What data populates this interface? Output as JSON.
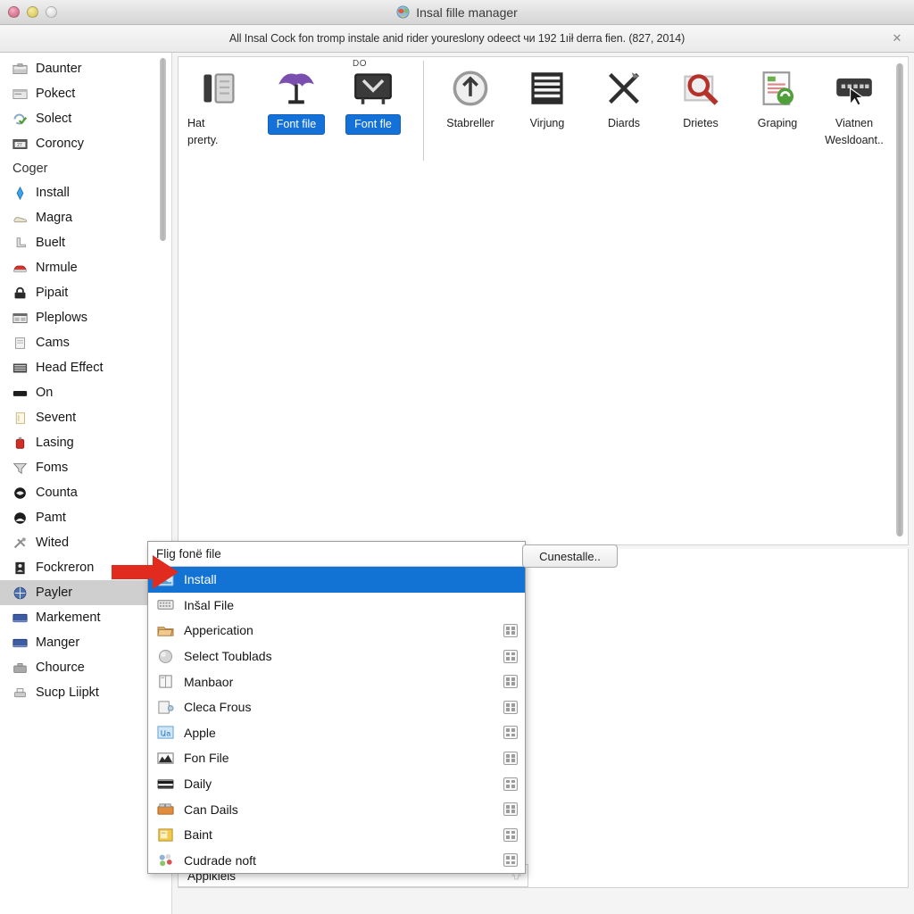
{
  "window": {
    "title": "Insal fille manager",
    "title_icon": "app-globe-icon",
    "controls": {
      "close": "close",
      "minimize": "minimize",
      "zoom": "zoom"
    }
  },
  "notice": {
    "text": "All Insal Cock fon tromp instale anid rider youreslony odeect чи 192 1ıił derra fien. (827, 2014)",
    "close_label": "✕"
  },
  "sidebar": {
    "items": [
      {
        "label": "Daunter",
        "icon": "briefcase-icon",
        "type": "item",
        "selected": false
      },
      {
        "label": "Pokect",
        "icon": "window-icon",
        "type": "item",
        "selected": false
      },
      {
        "label": "Solect",
        "icon": "refresh-check-icon",
        "type": "item",
        "selected": false
      },
      {
        "label": "Coroncy",
        "icon": "calendar-icon",
        "type": "item",
        "selected": false
      },
      {
        "label": "Coger",
        "icon": "",
        "type": "group",
        "selected": false
      },
      {
        "label": "Install",
        "icon": "blue-diamond-icon",
        "type": "item",
        "selected": false
      },
      {
        "label": "Magra",
        "icon": "shoe-icon",
        "type": "item",
        "selected": false
      },
      {
        "label": "Buelt",
        "icon": "boot-icon",
        "type": "item",
        "selected": false
      },
      {
        "label": "Nrmule",
        "icon": "car-icon",
        "type": "item",
        "selected": false
      },
      {
        "label": "Pipait",
        "icon": "lock-icon",
        "type": "item",
        "selected": false
      },
      {
        "label": "Pleplows",
        "icon": "grid-window-icon",
        "type": "item",
        "selected": false
      },
      {
        "label": "Cams",
        "icon": "document-icon",
        "type": "item",
        "selected": false
      },
      {
        "label": "Head Effect",
        "icon": "stripes-icon",
        "type": "item",
        "selected": false
      },
      {
        "label": "On",
        "icon": "black-bar-icon",
        "type": "item",
        "selected": false
      },
      {
        "label": "Sevent",
        "icon": "note-icon",
        "type": "item",
        "selected": false
      },
      {
        "label": "Lasing",
        "icon": "red-canister-icon",
        "type": "item",
        "selected": false
      },
      {
        "label": "Foms",
        "icon": "funnel-icon",
        "type": "item",
        "selected": false
      },
      {
        "label": "Counta",
        "icon": "globe-dark-icon",
        "type": "item",
        "selected": false
      },
      {
        "label": "Pamt",
        "icon": "circle-dark-icon",
        "type": "item",
        "selected": false
      },
      {
        "label": "Wited",
        "icon": "tools-icon",
        "type": "item",
        "selected": false
      },
      {
        "label": "Fockreron",
        "icon": "person-badge-icon",
        "type": "item",
        "selected": false
      },
      {
        "label": "Payler",
        "icon": "blue-globe-icon",
        "type": "item",
        "selected": true
      },
      {
        "label": "Markement",
        "icon": "blue-screen-icon",
        "type": "item",
        "selected": false
      },
      {
        "label": "Manger",
        "icon": "blue-screen-icon",
        "type": "item",
        "selected": false
      },
      {
        "label": "Chource",
        "icon": "toolbox-icon",
        "type": "item",
        "selected": false
      },
      {
        "label": "Sucp Liipkt",
        "icon": "printer-icon",
        "type": "item",
        "selected": false
      }
    ]
  },
  "toolbar": {
    "badge": "DO",
    "left_group": [
      {
        "label": "Hat\nprerty.",
        "icon": "phone-handset-icon",
        "pill": ""
      },
      {
        "label": "",
        "icon": "purple-umbrella-icon",
        "pill": "Font file"
      },
      {
        "label": "",
        "icon": "monitor-dark-icon",
        "pill": "Font fle"
      }
    ],
    "right_group": [
      {
        "label": "Stabreller",
        "icon": "upload-circle-icon"
      },
      {
        "label": "Virjung",
        "icon": "list-lines-icon"
      },
      {
        "label": "Diards",
        "icon": "scissors-icon"
      },
      {
        "label": "Drietes",
        "icon": "magnifier-icon"
      },
      {
        "label": "Graping",
        "icon": "document-sync-icon"
      },
      {
        "label": "Viatnen\nWesldoant..",
        "icon": "keyboard-cursor-icon"
      }
    ]
  },
  "popup": {
    "search_value": "Flig fonё file",
    "items": [
      {
        "label": "Install",
        "icon": "blue-window-icon",
        "selected": true,
        "badge": false
      },
      {
        "label": "Inšal File",
        "icon": "keyboard-grey-icon",
        "selected": false,
        "badge": false
      },
      {
        "label": "Apperication",
        "icon": "open-folder-icon",
        "selected": false,
        "badge": true
      },
      {
        "label": "Select Toublads",
        "icon": "grey-sphere-icon",
        "selected": false,
        "badge": true
      },
      {
        "label": "Manbaor",
        "icon": "book-icon",
        "selected": false,
        "badge": true
      },
      {
        "label": "Cleca Frous",
        "icon": "page-share-icon",
        "selected": false,
        "badge": true
      },
      {
        "label": "Apple",
        "icon": "blue-chart-icon",
        "selected": false,
        "badge": true
      },
      {
        "label": "Fon File",
        "icon": "mountain-photo-icon",
        "selected": false,
        "badge": true
      },
      {
        "label": "Daily",
        "icon": "dark-card-icon",
        "selected": false,
        "badge": true
      },
      {
        "label": "Can Dails",
        "icon": "orange-box-icon",
        "selected": false,
        "badge": true
      },
      {
        "label": "Baint",
        "icon": "yellow-note-icon",
        "selected": false,
        "badge": true
      },
      {
        "label": "Cudrade noft",
        "icon": "colorful-apps-icon",
        "selected": false,
        "badge": true
      }
    ]
  },
  "uninstall_button": {
    "label": "Cunestalle.."
  },
  "bottom_bar": {
    "label": "Applkiels"
  },
  "pointer": {
    "type": "red-arrow",
    "direction": "right"
  },
  "colors": {
    "accent_blue": "#1273d5",
    "pill_blue": "#1471d8",
    "selection_grey": "#cfcfcf",
    "arrow_red": "#e02b1e",
    "window_chrome": "#e2e1e1"
  }
}
